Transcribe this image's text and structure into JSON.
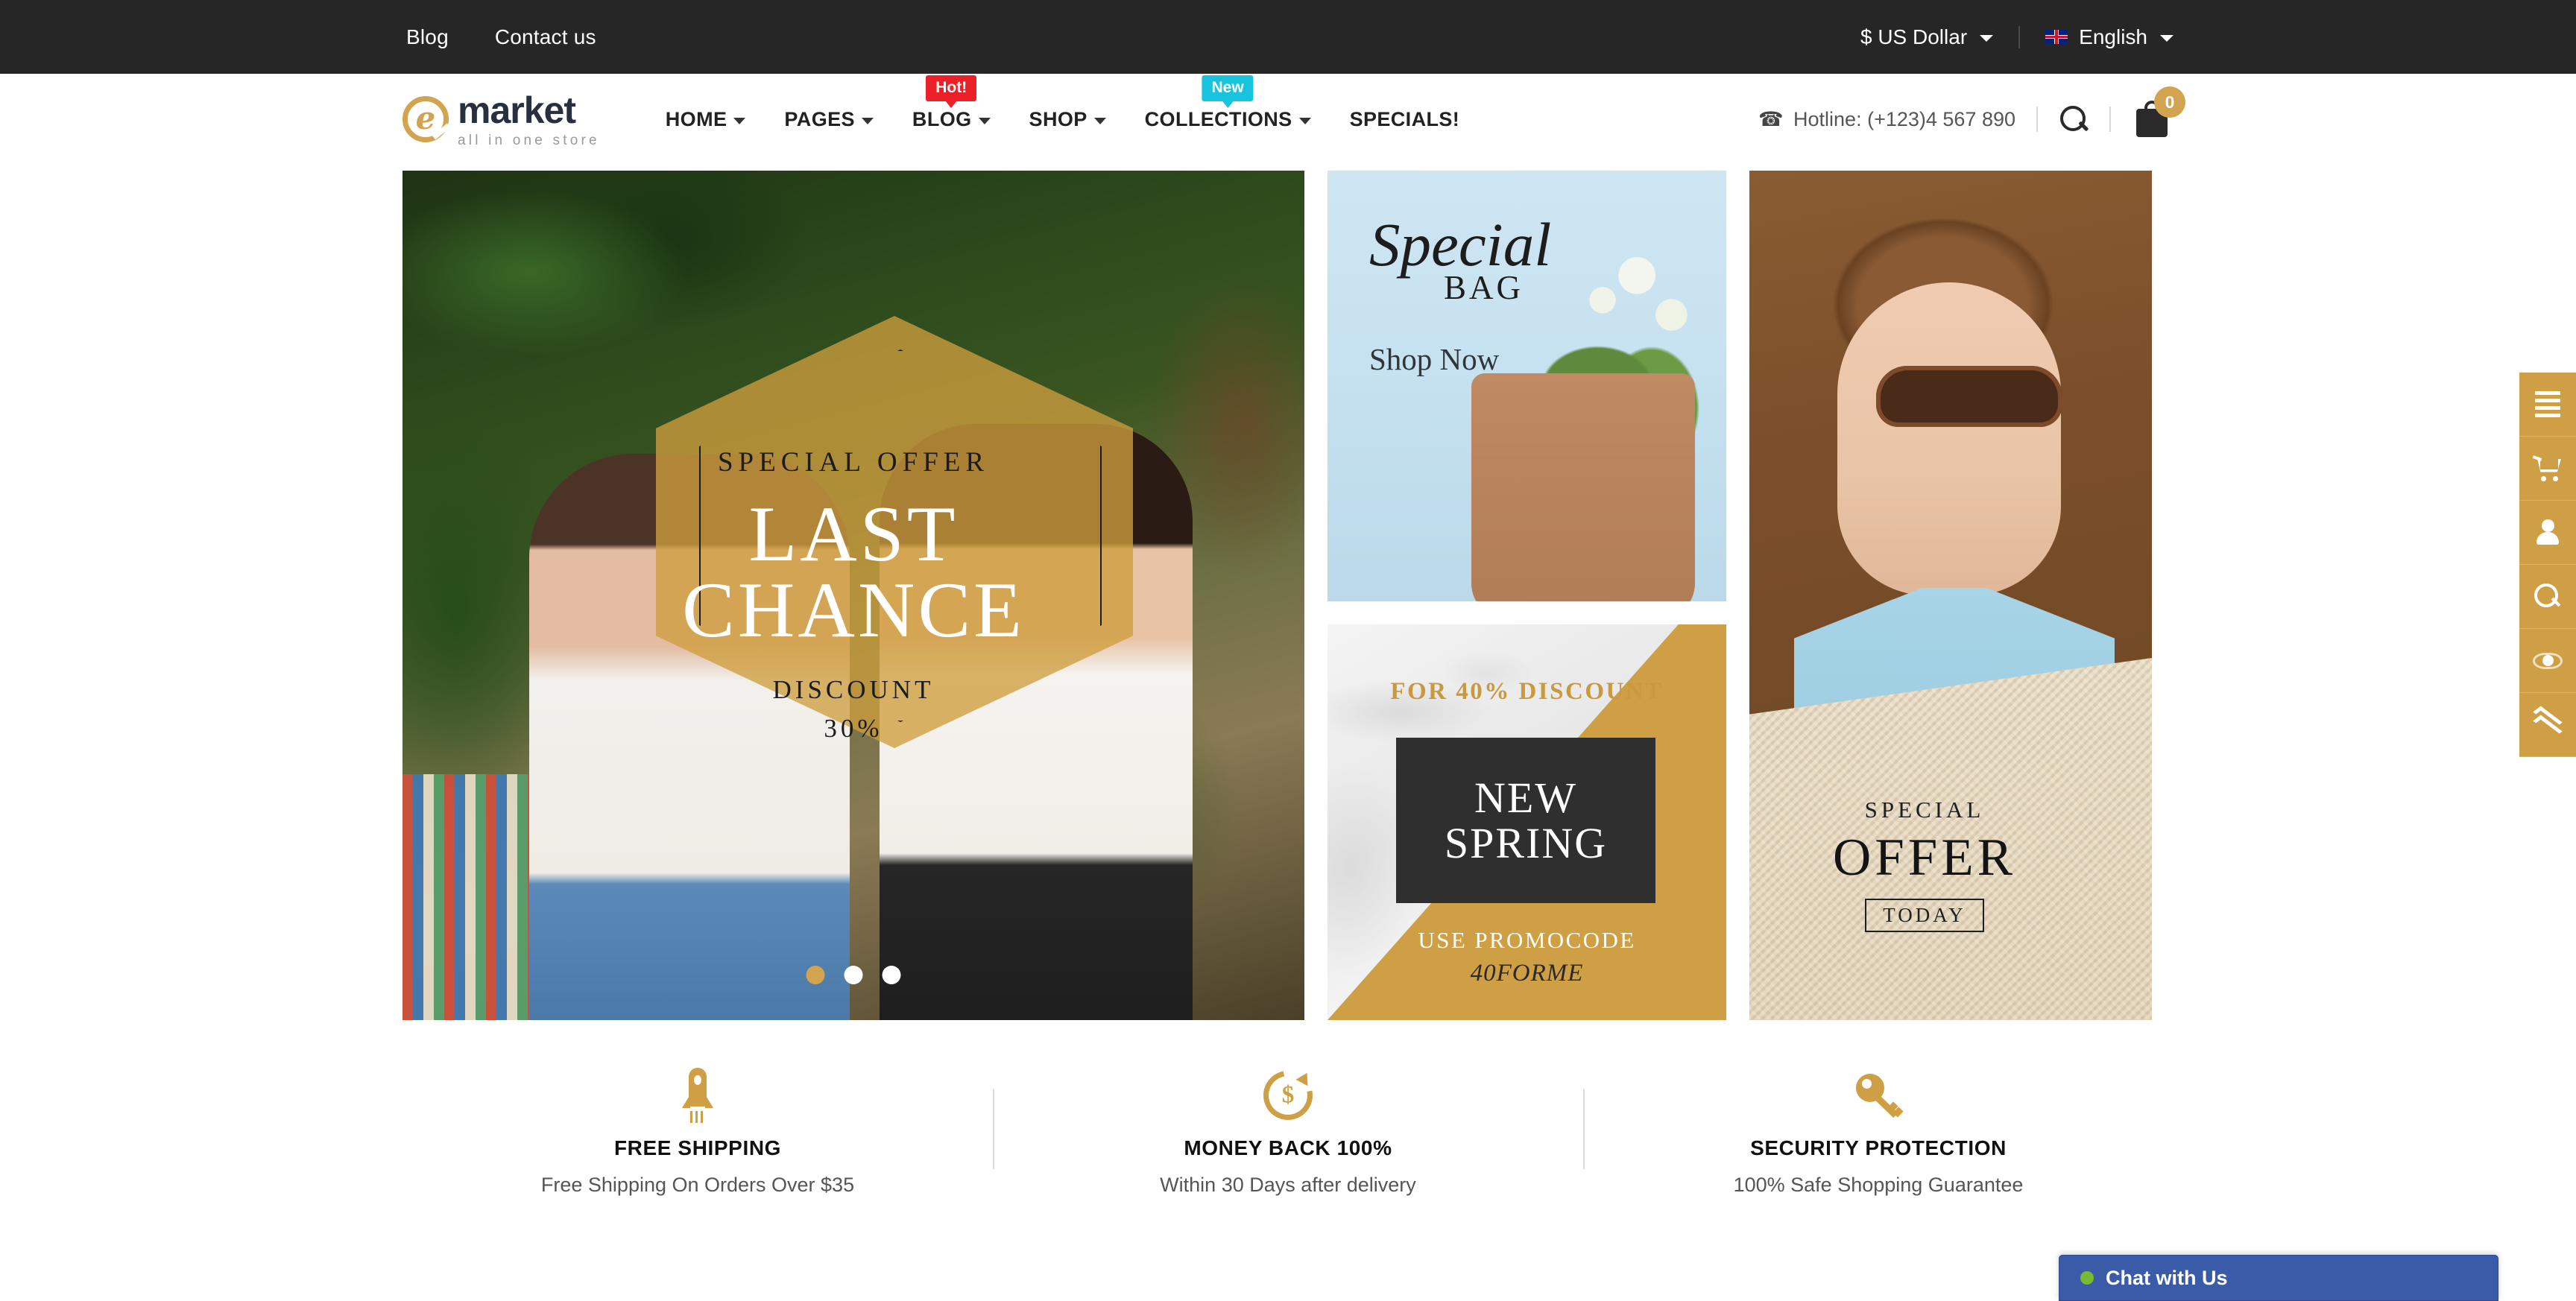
{
  "topbar": {
    "links": [
      {
        "label": "Blog"
      },
      {
        "label": "Contact us"
      }
    ],
    "currency": {
      "label": "$ US Dollar",
      "icon": "chevron-down-icon"
    },
    "language": {
      "label": "English",
      "flag": "uk-flag-icon",
      "icon": "chevron-down-icon"
    }
  },
  "header": {
    "logo": {
      "mark": "e-circle-icon",
      "name": "market",
      "tagline": "all in one store"
    },
    "nav": [
      {
        "label": "HOME",
        "has_caret": true,
        "badge": null
      },
      {
        "label": "PAGES",
        "has_caret": true,
        "badge": null
      },
      {
        "label": "BLOG",
        "has_caret": true,
        "badge": "Hot!",
        "badge_color": "#ec2028"
      },
      {
        "label": "SHOP",
        "has_caret": true,
        "badge": null
      },
      {
        "label": "COLLECTIONS",
        "has_caret": true,
        "badge": "New",
        "badge_color": "#18c3dd"
      },
      {
        "label": "SPECIALS!",
        "has_caret": false,
        "badge": null
      }
    ],
    "hotline": {
      "icon": "phone-icon",
      "label": "Hotline: (+123)4 567 890"
    },
    "search": {
      "icon": "search-icon"
    },
    "cart": {
      "icon": "shopping-bag-icon",
      "count": "0"
    }
  },
  "banners": {
    "hero": {
      "eyebrow": "SPECIAL OFFER",
      "title_line1": "LAST",
      "title_line2": "CHANCE",
      "discount_label": "DISCOUNT",
      "discount_value": "30%",
      "dots": [
        {
          "active": true
        },
        {
          "active": false
        },
        {
          "active": false
        }
      ]
    },
    "special_bag": {
      "title": "Special",
      "subtitle": "BAG",
      "cta": "Shop Now"
    },
    "new_spring": {
      "top_text": "FOR 40% DISCOUNT",
      "box_line1": "NEW",
      "box_line2": "SPRING",
      "promo_label": "USE PROMOCODE",
      "promo_code": "40FORME"
    },
    "special_offer": {
      "line1": "SPECIAL",
      "line2": "OFFER",
      "line3": "TODAY"
    }
  },
  "features": [
    {
      "icon": "rocket-icon",
      "title": "FREE SHIPPING",
      "desc": "Free Shipping On Orders Over $35"
    },
    {
      "icon": "money-back-icon",
      "title": "MONEY BACK 100%",
      "desc": "Within 30 Days after delivery"
    },
    {
      "icon": "key-icon",
      "title": "SECURITY PROTECTION",
      "desc": "100% Safe Shopping Guarantee"
    }
  ],
  "side_toolbar": [
    {
      "icon": "menu-icon",
      "name": "menu"
    },
    {
      "icon": "cart-icon",
      "name": "cart"
    },
    {
      "icon": "user-icon",
      "name": "account"
    },
    {
      "icon": "search-icon",
      "name": "search"
    },
    {
      "icon": "eye-icon",
      "name": "recently-viewed"
    },
    {
      "icon": "chevron-double-up-icon",
      "name": "back-to-top"
    }
  ],
  "chat": {
    "label": "Chat with Us",
    "status": "online"
  },
  "colors": {
    "accent_gold": "#cf9f45",
    "topbar_bg": "#262626",
    "badge_hot": "#ec2028",
    "badge_new": "#18c3dd",
    "chat_blue": "#3a5ca8",
    "chat_dot_green": "#76bb2e"
  }
}
